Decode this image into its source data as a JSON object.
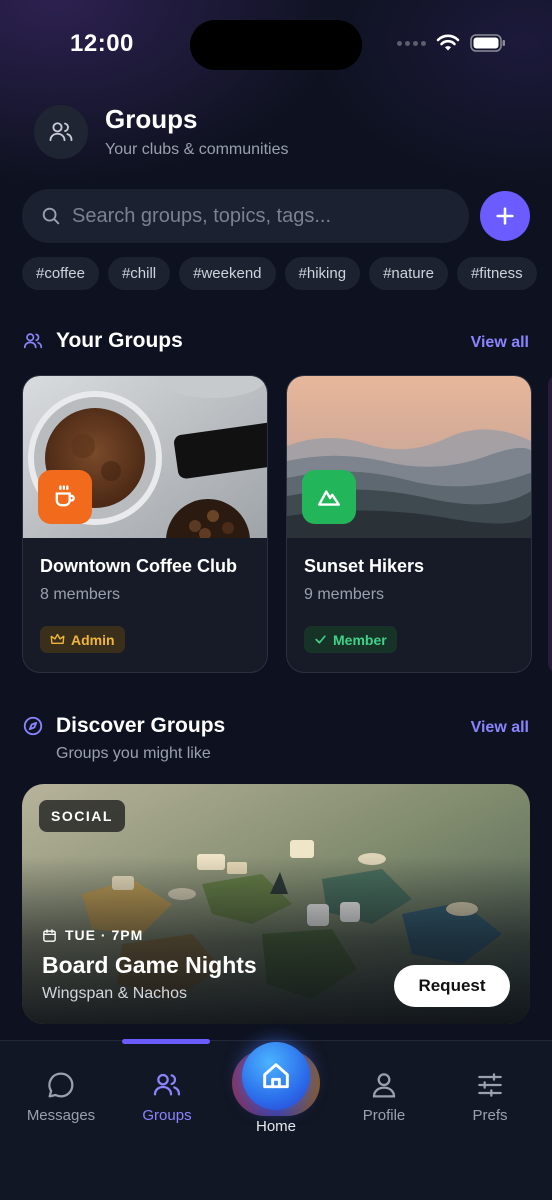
{
  "status_bar": {
    "time": "12:00"
  },
  "header": {
    "title": "Groups",
    "subtitle": "Your clubs & communities",
    "icon": "users-icon"
  },
  "search": {
    "placeholder": "Search groups, topics, tags..."
  },
  "tags": [
    "#coffee",
    "#chill",
    "#weekend",
    "#hiking",
    "#nature",
    "#fitness"
  ],
  "your_groups": {
    "title": "Your Groups",
    "view_all": "View all",
    "items": [
      {
        "name": "Downtown Coffee Club",
        "members": "8 members",
        "role": "Admin",
        "icon": "coffee-cup-icon",
        "icon_color": "#f26b1d"
      },
      {
        "name": "Sunset Hikers",
        "members": "9 members",
        "role": "Member",
        "icon": "mountain-icon",
        "icon_color": "#22b55a"
      }
    ]
  },
  "discover": {
    "title": "Discover Groups",
    "subtitle": "Groups you might like",
    "view_all": "View all",
    "event": {
      "category": "SOCIAL",
      "time": "TUE · 7PM",
      "title": "Board Game Nights",
      "subtitle": "Wingspan & Nachos",
      "action": "Request"
    }
  },
  "tab_bar": {
    "items": [
      {
        "label": "Messages",
        "icon": "chat-bubble-icon"
      },
      {
        "label": "Groups",
        "icon": "users-icon",
        "active": true
      },
      {
        "label": "Home",
        "icon": "home-icon"
      },
      {
        "label": "Profile",
        "icon": "person-icon"
      },
      {
        "label": "Prefs",
        "icon": "sliders-icon"
      }
    ]
  },
  "colors": {
    "accent": "#6a5cff",
    "link": "#8a84ff",
    "background": "#0e1220",
    "card": "#161b27"
  }
}
